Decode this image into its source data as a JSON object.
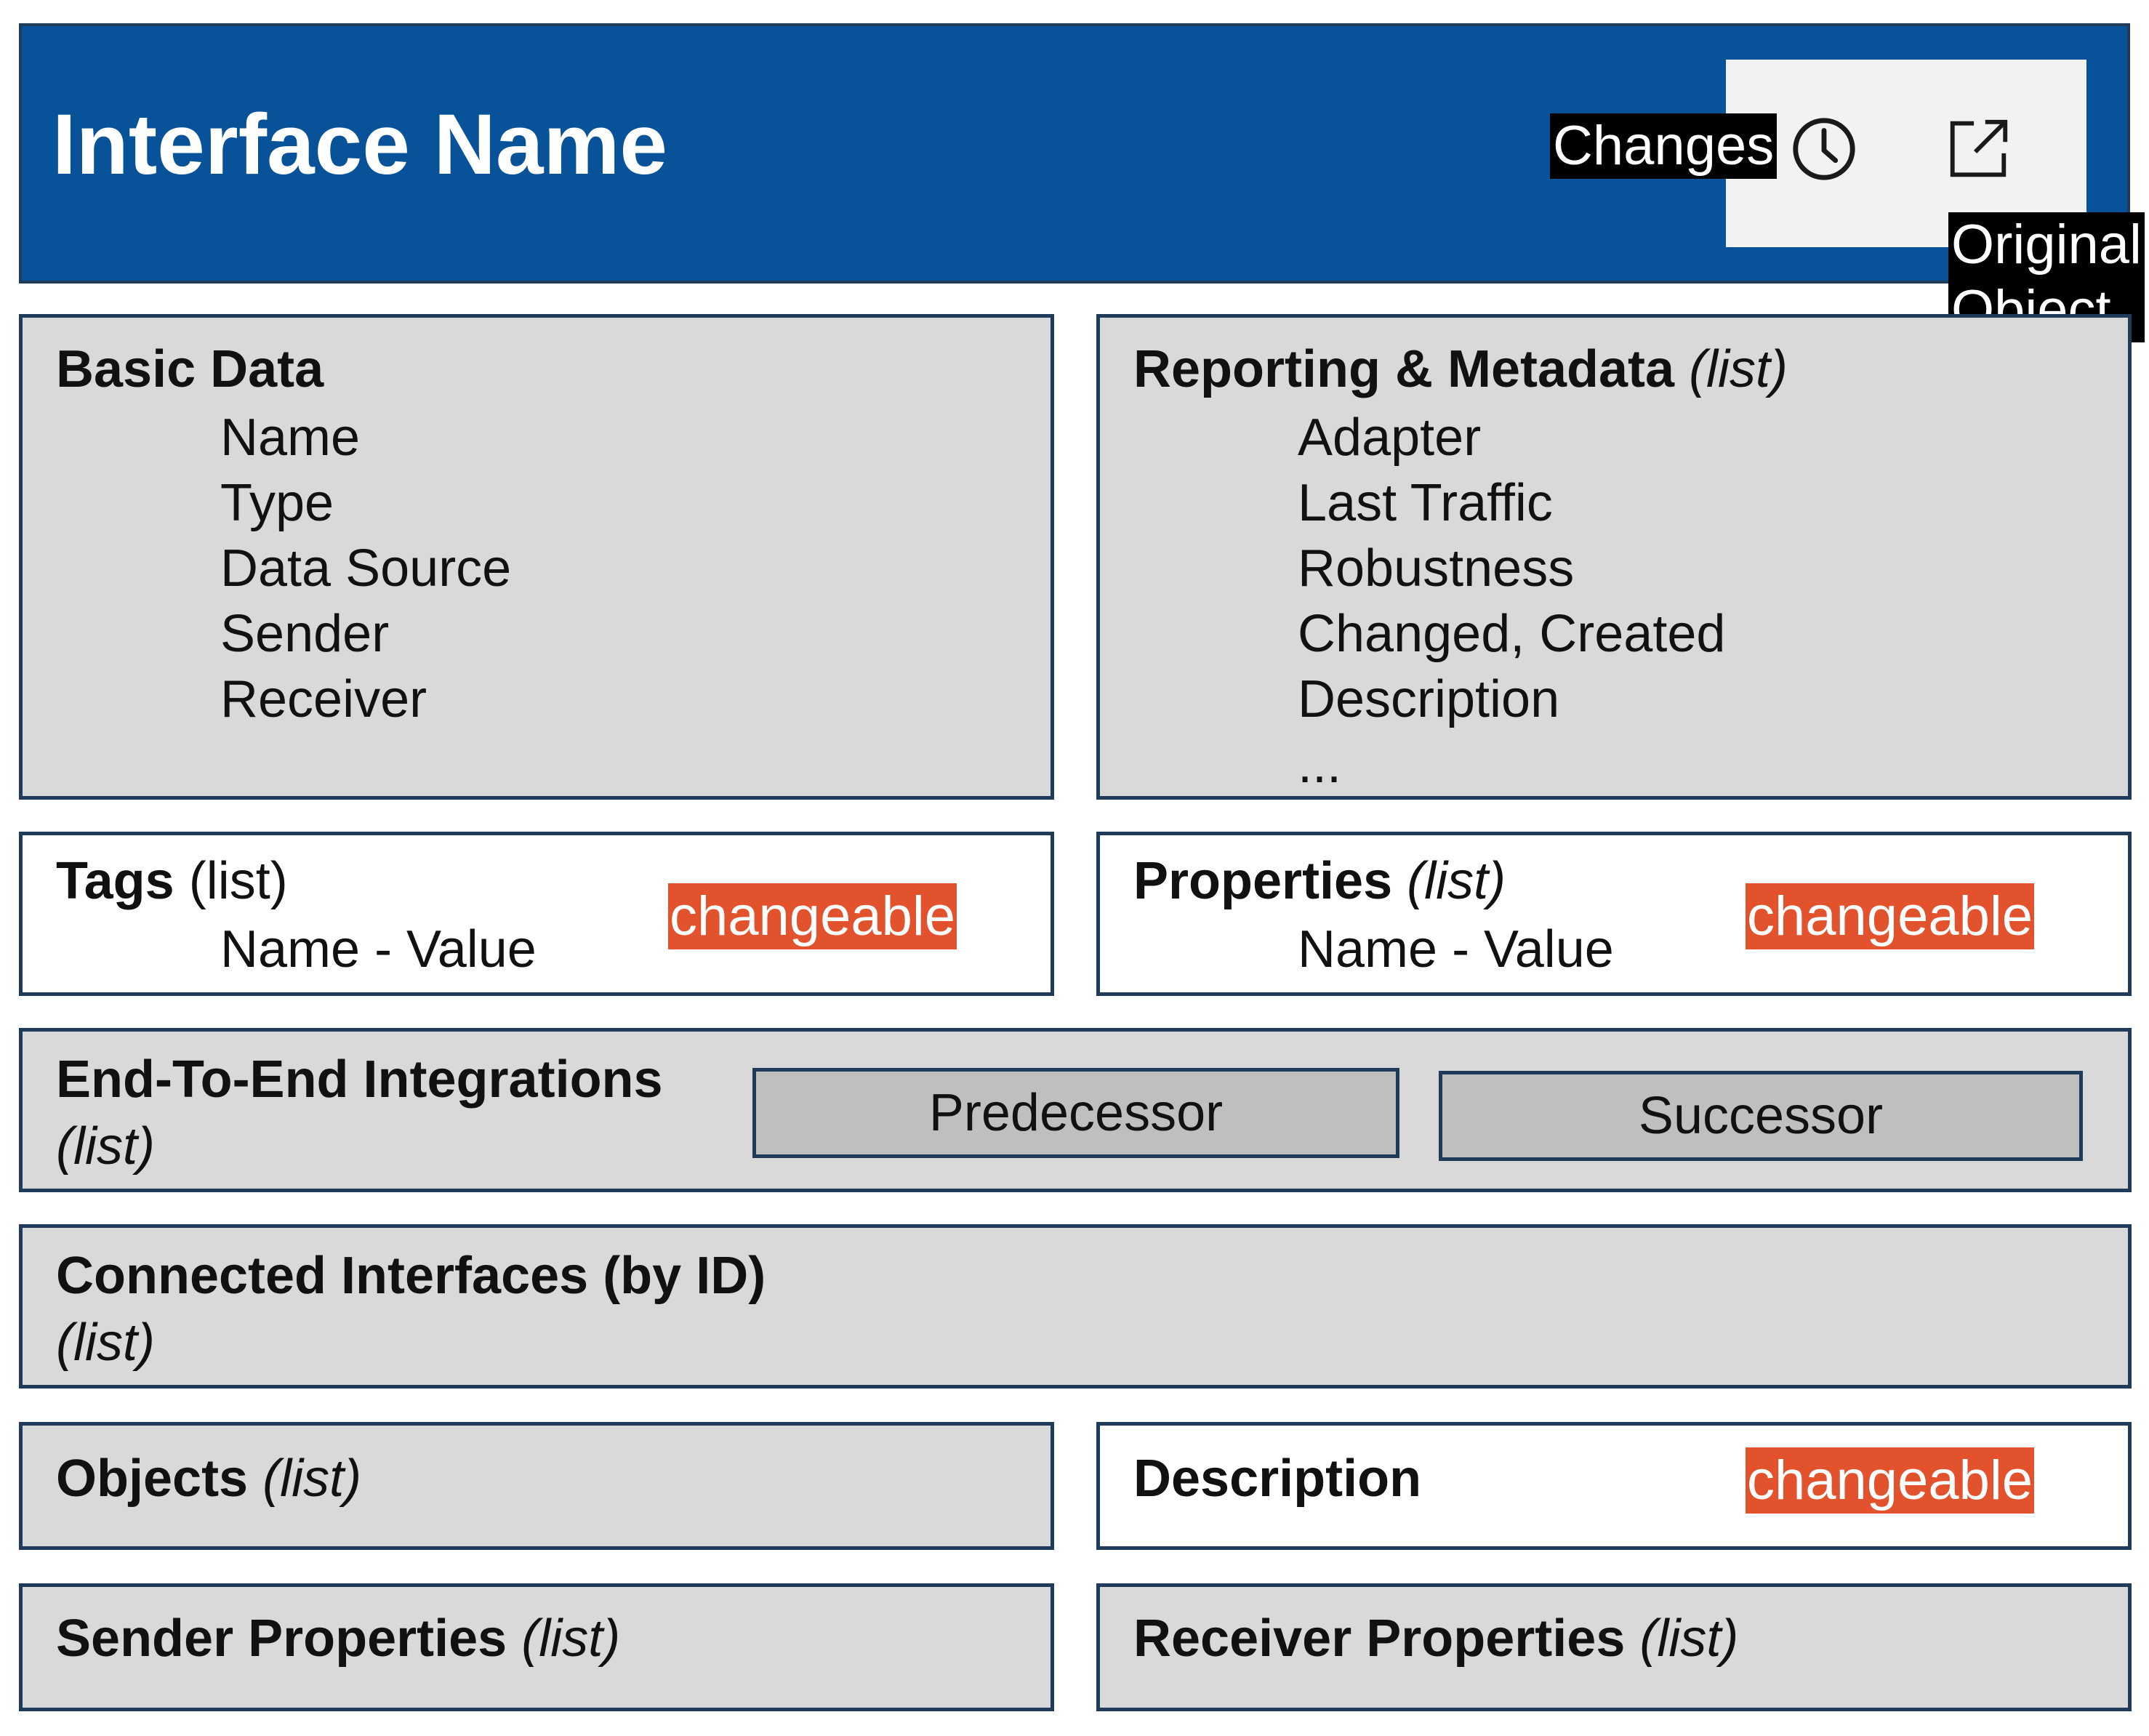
{
  "header": {
    "title": "Interface Name",
    "changes_label": "Changes",
    "original_object_label": [
      "Original",
      "Object"
    ],
    "icons": [
      "clock-icon",
      "external-link-icon"
    ]
  },
  "basic_data": {
    "title": "Basic Data",
    "items": [
      "Name",
      "Type",
      "Data Source",
      "Sender",
      "Receiver"
    ]
  },
  "reporting": {
    "title": "Reporting & Metadata",
    "suffix": "(list)",
    "items": [
      "Adapter",
      "Last Traffic",
      "Robustness",
      "Changed, Created",
      "Description",
      "..."
    ]
  },
  "tags": {
    "title": "Tags",
    "suffix": "(list)",
    "item": "Name - Value",
    "badge": "changeable"
  },
  "properties": {
    "title": "Properties",
    "suffix": "(list)",
    "item": "Name - Value",
    "badge": "changeable"
  },
  "e2e": {
    "title": "End-To-End Integrations",
    "suffix": "(list)",
    "predecessor": "Predecessor",
    "successor": "Successor"
  },
  "connected": {
    "title": "Connected Interfaces (by ID)",
    "suffix": "(list)"
  },
  "objects": {
    "title": "Objects",
    "suffix": "(list)"
  },
  "description": {
    "title": "Description",
    "badge": "changeable"
  },
  "sender_props": {
    "title": "Sender Properties",
    "suffix": "(list)"
  },
  "receiver_props": {
    "title": "Receiver Properties",
    "suffix": "(list)"
  },
  "colors": {
    "header_blue": "#08529a",
    "border_navy": "#1f3b5a",
    "panel_grey": "#d9d9d9",
    "button_grey": "#bfbfbf",
    "badge_orange": "#e2522c"
  }
}
